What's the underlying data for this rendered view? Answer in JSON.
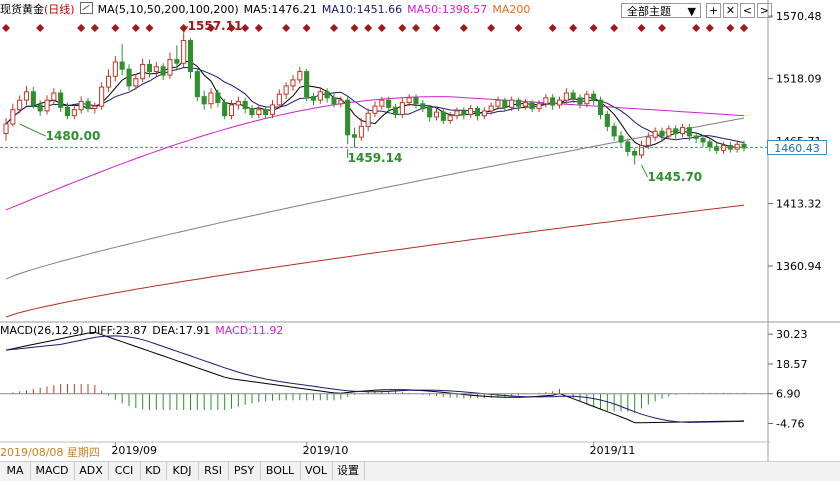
{
  "header": {
    "instrument": "现货黄金",
    "period": "(日线)",
    "ma_label": "MA(5,10,50,200,100,200)",
    "ma5": "MA5:1476.21",
    "ma10": "MA10:1451.66",
    "ma50": "MA50:1398.57",
    "ma200": "MA200"
  },
  "toolbar": {
    "theme_label": "全部主题",
    "theme_arrow": "▼",
    "btn_add": "+",
    "btn_close": "✕",
    "btn_left": "<",
    "btn_right": ">"
  },
  "colors": {
    "up": "#c0392b",
    "down": "#2f8f2f",
    "ma5": "#000000",
    "ma10": "#1a1a70",
    "ma50": "#d020d0",
    "ma100": "#808080",
    "ma200": "#b03020",
    "macd_dea": "#1a1a70",
    "macd_diff": "#000000",
    "last_price": "#3a8fc0"
  },
  "chart_data": {
    "type": "candlestick",
    "price_axis_ticks": [
      "1570.48",
      "1518.09",
      "1465.71",
      "1413.32",
      "1360.94"
    ],
    "ylim": [
      1314,
      1584
    ],
    "last_price": "1460.43",
    "last_price_value": 1460.43,
    "annotations": [
      {
        "label": "1557.11",
        "value": 1557.11
      },
      {
        "label": "1480.00",
        "value": 1480.0
      },
      {
        "label": "1459.14",
        "value": 1459.14
      },
      {
        "label": "1445.70",
        "value": 1445.7
      }
    ],
    "candles": [
      [
        1472,
        1480,
        1466,
        1485
      ],
      [
        1480,
        1492,
        1478,
        1497
      ],
      [
        1492,
        1500,
        1489,
        1504
      ],
      [
        1500,
        1507,
        1496,
        1512
      ],
      [
        1507,
        1496,
        1493,
        1511
      ],
      [
        1496,
        1491,
        1487,
        1500
      ],
      [
        1491,
        1500,
        1488,
        1504
      ],
      [
        1500,
        1506,
        1496,
        1510
      ],
      [
        1506,
        1494,
        1490,
        1509
      ],
      [
        1494,
        1487,
        1484,
        1498
      ],
      [
        1487,
        1492,
        1484,
        1496
      ],
      [
        1492,
        1499,
        1489,
        1503
      ],
      [
        1499,
        1493,
        1490,
        1502
      ],
      [
        1493,
        1495,
        1489,
        1498
      ],
      [
        1495,
        1511,
        1492,
        1515
      ],
      [
        1511,
        1520,
        1507,
        1526
      ],
      [
        1520,
        1532,
        1516,
        1537
      ],
      [
        1532,
        1526,
        1521,
        1547
      ],
      [
        1526,
        1512,
        1508,
        1530
      ],
      [
        1512,
        1518,
        1509,
        1522
      ],
      [
        1518,
        1530,
        1515,
        1535
      ],
      [
        1530,
        1524,
        1519,
        1534
      ],
      [
        1524,
        1528,
        1520,
        1532
      ],
      [
        1528,
        1521,
        1517,
        1531
      ],
      [
        1521,
        1534,
        1518,
        1540
      ],
      [
        1534,
        1531,
        1526,
        1546
      ],
      [
        1531,
        1550,
        1528,
        1557
      ],
      [
        1550,
        1524,
        1518,
        1552
      ],
      [
        1524,
        1503,
        1499,
        1526
      ],
      [
        1503,
        1497,
        1492,
        1508
      ],
      [
        1497,
        1506,
        1493,
        1510
      ],
      [
        1506,
        1498,
        1494,
        1509
      ],
      [
        1498,
        1487,
        1484,
        1501
      ],
      [
        1487,
        1496,
        1484,
        1500
      ],
      [
        1496,
        1499,
        1492,
        1503
      ],
      [
        1499,
        1493,
        1489,
        1502
      ],
      [
        1493,
        1488,
        1485,
        1496
      ],
      [
        1488,
        1492,
        1485,
        1496
      ],
      [
        1492,
        1488,
        1485,
        1495
      ],
      [
        1488,
        1496,
        1485,
        1500
      ],
      [
        1496,
        1505,
        1493,
        1509
      ],
      [
        1505,
        1512,
        1501,
        1515
      ],
      [
        1512,
        1517,
        1508,
        1521
      ],
      [
        1517,
        1524,
        1514,
        1528
      ],
      [
        1524,
        1503,
        1499,
        1526
      ],
      [
        1503,
        1500,
        1496,
        1506
      ],
      [
        1500,
        1507,
        1497,
        1511
      ],
      [
        1507,
        1502,
        1498,
        1510
      ],
      [
        1502,
        1497,
        1494,
        1506
      ],
      [
        1497,
        1500,
        1494,
        1503
      ],
      [
        1500,
        1471,
        1463,
        1503
      ],
      [
        1471,
        1469,
        1460,
        1477
      ],
      [
        1469,
        1478,
        1466,
        1485
      ],
      [
        1478,
        1489,
        1474,
        1493
      ],
      [
        1489,
        1495,
        1486,
        1499
      ],
      [
        1495,
        1500,
        1492,
        1503
      ],
      [
        1500,
        1494,
        1490,
        1503
      ],
      [
        1494,
        1488,
        1485,
        1497
      ],
      [
        1488,
        1498,
        1485,
        1502
      ],
      [
        1498,
        1502,
        1495,
        1505
      ],
      [
        1502,
        1497,
        1493,
        1505
      ],
      [
        1497,
        1493,
        1490,
        1500
      ],
      [
        1493,
        1486,
        1482,
        1496
      ],
      [
        1486,
        1490,
        1483,
        1494
      ],
      [
        1490,
        1483,
        1480,
        1493
      ],
      [
        1483,
        1487,
        1480,
        1490
      ],
      [
        1487,
        1491,
        1484,
        1494
      ],
      [
        1491,
        1488,
        1484,
        1494
      ],
      [
        1488,
        1493,
        1485,
        1496
      ],
      [
        1493,
        1487,
        1483,
        1495
      ],
      [
        1487,
        1491,
        1484,
        1494
      ],
      [
        1491,
        1495,
        1488,
        1498
      ],
      [
        1495,
        1500,
        1492,
        1503
      ],
      [
        1500,
        1494,
        1491,
        1502
      ],
      [
        1494,
        1500,
        1491,
        1503
      ],
      [
        1500,
        1495,
        1491,
        1502
      ],
      [
        1495,
        1498,
        1492,
        1501
      ],
      [
        1498,
        1493,
        1490,
        1500
      ],
      [
        1493,
        1497,
        1490,
        1500
      ],
      [
        1497,
        1502,
        1494,
        1505
      ],
      [
        1502,
        1496,
        1492,
        1505
      ],
      [
        1496,
        1500,
        1493,
        1503
      ],
      [
        1500,
        1506,
        1497,
        1510
      ],
      [
        1506,
        1502,
        1498,
        1509
      ],
      [
        1502,
        1497,
        1493,
        1505
      ],
      [
        1497,
        1505,
        1494,
        1508
      ],
      [
        1505,
        1500,
        1496,
        1508
      ],
      [
        1500,
        1488,
        1484,
        1503
      ],
      [
        1488,
        1478,
        1474,
        1491
      ],
      [
        1478,
        1470,
        1466,
        1481
      ],
      [
        1470,
        1465,
        1461,
        1474
      ],
      [
        1465,
        1457,
        1453,
        1468
      ],
      [
        1457,
        1454,
        1446,
        1460
      ],
      [
        1454,
        1462,
        1451,
        1466
      ],
      [
        1462,
        1469,
        1459,
        1473
      ],
      [
        1469,
        1474,
        1466,
        1477
      ],
      [
        1474,
        1470,
        1466,
        1477
      ],
      [
        1470,
        1476,
        1467,
        1479
      ],
      [
        1476,
        1472,
        1468,
        1479
      ],
      [
        1472,
        1477,
        1469,
        1480
      ],
      [
        1477,
        1470,
        1466,
        1480
      ],
      [
        1470,
        1468,
        1464,
        1473
      ],
      [
        1468,
        1465,
        1461,
        1471
      ],
      [
        1465,
        1461,
        1457,
        1468
      ],
      [
        1461,
        1458,
        1455,
        1464
      ],
      [
        1458,
        1462,
        1455,
        1465
      ],
      [
        1462,
        1459,
        1456,
        1465
      ],
      [
        1459,
        1463,
        1456,
        1466
      ],
      [
        1463,
        1460,
        1457,
        1466
      ]
    ],
    "moving_averages": {
      "ma5": {
        "start": 1460,
        "end": 1476.21
      },
      "ma10": {
        "start": 1452,
        "end": 1451.66
      },
      "ma50": {
        "start": 1405,
        "end": 1398.57
      },
      "ma100": {
        "start": 1370,
        "end": 1470
      },
      "ma200": {
        "start": 1318,
        "end": 1412
      }
    },
    "dates": [
      {
        "label": "2019/08/08 星期四",
        "index": 0
      },
      {
        "label": "2019/09",
        "index": 16
      },
      {
        "label": "2019/10",
        "index": 44
      },
      {
        "label": "2019/11",
        "index": 86
      }
    ],
    "macd": {
      "params": "MACD(26,12,9)",
      "diff_label": "DIFF:23.87",
      "dea_label": "DEA:17.91",
      "macd_label": "MACD:11.92",
      "axis_ticks": [
        "30.23",
        "18.57",
        "6.90",
        "-4.76"
      ],
      "ylim": [
        -12,
        35
      ]
    }
  },
  "tabs": [
    "MA",
    "MACD",
    "ADX",
    "CCI",
    "KD",
    "KDJ",
    "RSI",
    "PSY",
    "BOLL",
    "VOL",
    "设置"
  ]
}
